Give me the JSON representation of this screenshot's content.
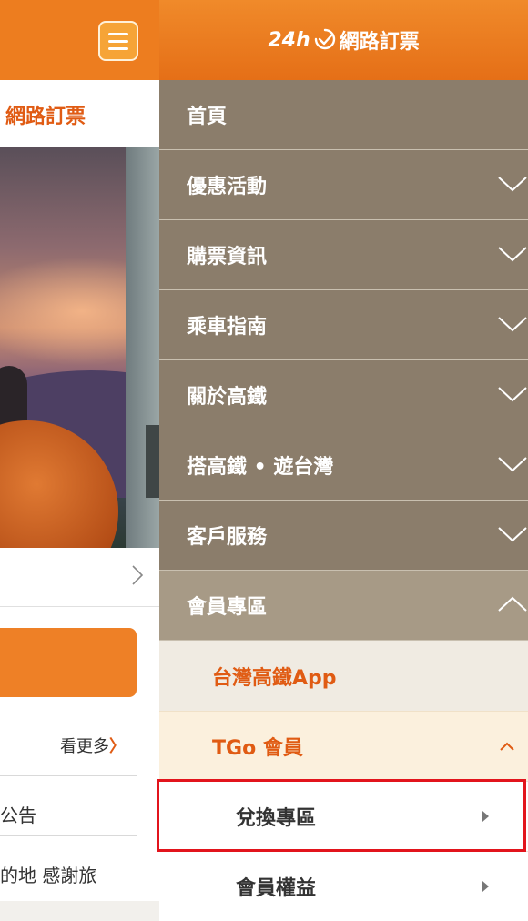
{
  "left_page": {
    "brand_text": "網路訂票",
    "more_label": "看更多",
    "more_chevron": "〉",
    "notice_text": "公告",
    "line2_text": "的地 感謝旅",
    "arrow_icon": "chevron-right-icon"
  },
  "drawer": {
    "logo_number": "24h",
    "logo_text": "網路訂票",
    "menu": [
      {
        "label": "首頁"
      },
      {
        "label": "優惠活動"
      },
      {
        "label": "購票資訊"
      },
      {
        "label": "乘車指南"
      },
      {
        "label": "關於高鐵"
      },
      {
        "label": "搭高鐵 • 遊台灣"
      },
      {
        "label": "客戶服務"
      },
      {
        "label": "會員專區"
      }
    ],
    "member_sub": {
      "app_label": "台灣高鐵App",
      "tgo_label": "TGo 會員",
      "tgo_items": [
        {
          "label": "兌換專區"
        },
        {
          "label": "會員權益"
        }
      ]
    }
  },
  "colors": {
    "brand_orange": "#ed7d1f",
    "menu_brown": "#8b7d6b",
    "menu_active": "#a79a86",
    "highlight": "#e2141c"
  }
}
